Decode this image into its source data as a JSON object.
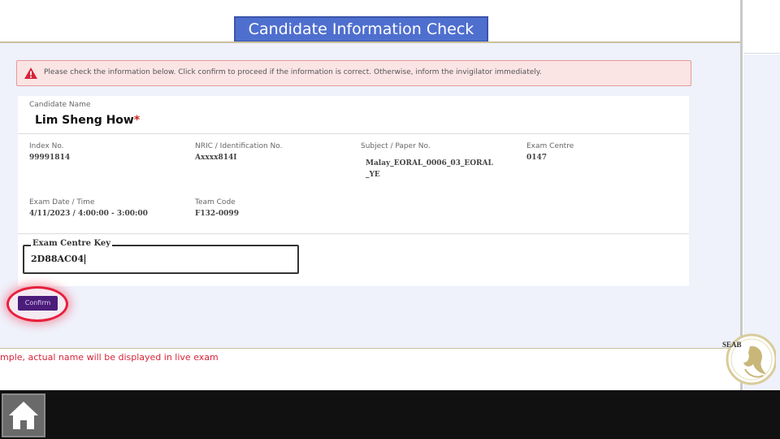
{
  "page": {
    "title": "Candidate Information Check"
  },
  "alert": {
    "text": "Please check the information below. Click confirm to proceed if the information is correct. Otherwise, inform the invigilator immediately.",
    "icon": "warning-icon"
  },
  "candidate": {
    "name_label": "Candidate Name",
    "name": "Lim Sheng How",
    "required_mark": "*"
  },
  "details": {
    "index_label": "Index No.",
    "index_value": "99991814",
    "nric_label": "NRIC / Identification No.",
    "nric_value": "Axxxx814I",
    "subject_label": "Subject / Paper No.",
    "subject_value_line1": "Malay_EORAL_0006_03_EORAL",
    "subject_value_line2": "_YE",
    "centre_label": "Exam Centre",
    "centre_value": "0147",
    "date_label": "Exam Date / Time",
    "date_value": "4/11/2023 / 4:00:00 - 3:00:00",
    "team_label": "Team Code",
    "team_value": "F132-0099"
  },
  "key_field": {
    "label": "Exam Centre Key",
    "value": "2D88AC04"
  },
  "confirm_button": {
    "label": "Confirm"
  },
  "footer": {
    "note": "mple, actual name will be displayed in live exam",
    "seal_text": "SEAB"
  },
  "taskbar": {
    "home_icon": "home-icon"
  },
  "colors": {
    "banner": "#4f6fcf",
    "alert_bg": "#fbe4e4",
    "alert_border": "#e59a9a",
    "confirm_bg": "#4b1c7a",
    "highlight": "#e8203c",
    "footer_text": "#d6243a",
    "taskbar": "#111111"
  }
}
